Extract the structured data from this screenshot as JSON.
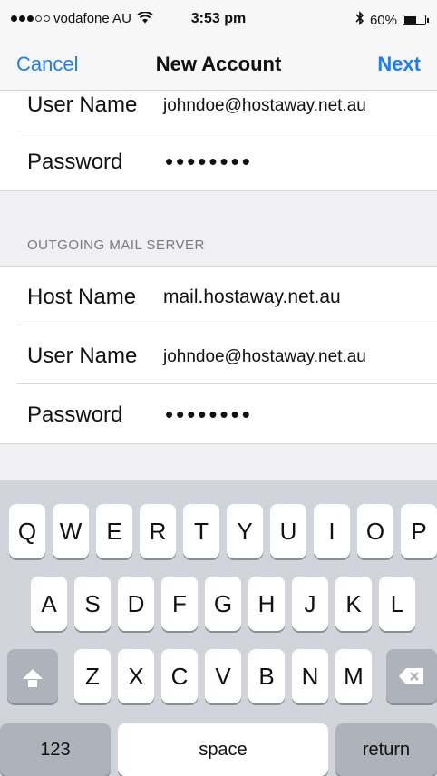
{
  "status_bar": {
    "carrier": "vodafone AU",
    "time": "3:53 pm",
    "battery_text": "60%",
    "battery_level": 0.6,
    "signal_bars": 5,
    "signal_filled": 3
  },
  "nav": {
    "cancel_label": "Cancel",
    "title": "New Account",
    "next_label": "Next",
    "accent_color": "#1a7ef5"
  },
  "incoming": {
    "user_name_label": "User Name",
    "user_name_value": "johndoe@hostaway.net.au",
    "password_label": "Password",
    "password_value": "••••••••"
  },
  "outgoing": {
    "header": "OUTGOING MAIL SERVER",
    "host_name_label": "Host Name",
    "host_name_value": "mail.hostaway.net.au",
    "user_name_label": "User Name",
    "user_name_value": "johndoe@hostaway.net.au",
    "password_label": "Password",
    "password_value": "••••••••"
  },
  "keyboard": {
    "row1": [
      "Q",
      "W",
      "E",
      "R",
      "T",
      "Y",
      "U",
      "I",
      "O",
      "P"
    ],
    "row2": [
      "A",
      "S",
      "D",
      "F",
      "G",
      "H",
      "J",
      "K",
      "L"
    ],
    "row3": [
      "Z",
      "X",
      "C",
      "V",
      "B",
      "N",
      "M"
    ],
    "numbers_label": "123",
    "space_label": "space",
    "return_label": "return"
  }
}
